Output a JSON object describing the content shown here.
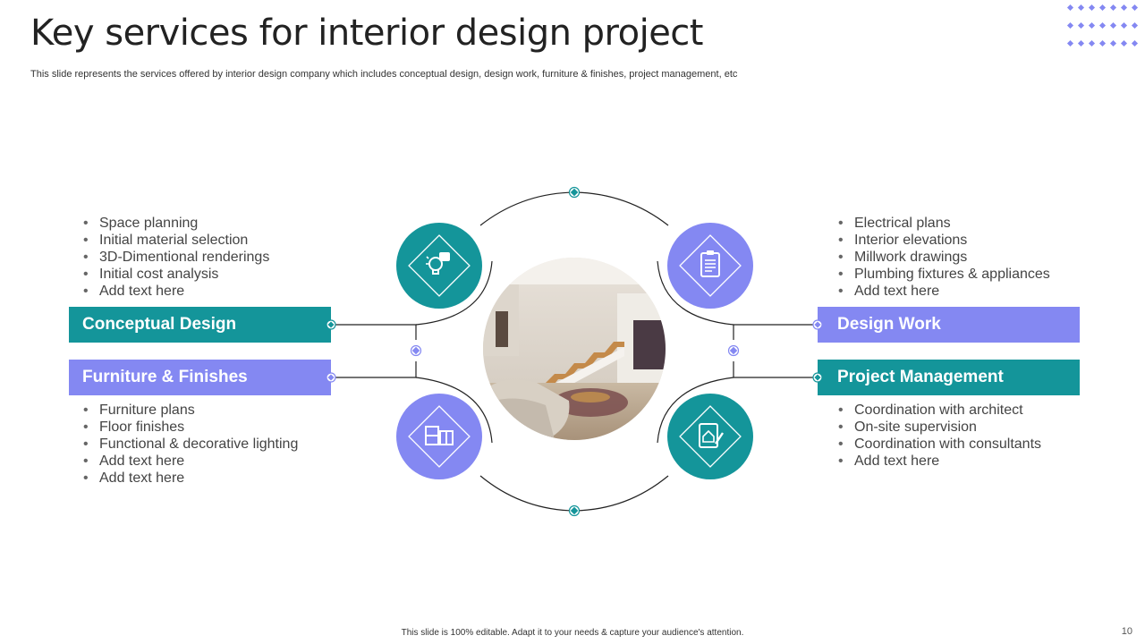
{
  "header": {
    "title": "Key services for interior design project",
    "subtitle": "This slide represents the services offered by interior design company which includes conceptual design, design work, furniture & finishes, project management, etc"
  },
  "colors": {
    "teal": "#14959a",
    "purple": "#8488f2"
  },
  "services": {
    "conceptual": {
      "label": "Conceptual Design",
      "icon": "lightbulb-idea-icon",
      "items": [
        "Space planning",
        "Initial material selection",
        "3D-Dimentional renderings",
        "Initial cost analysis",
        "Add text here"
      ]
    },
    "furniture": {
      "label": "Furniture & Finishes",
      "icon": "furniture-cabinet-icon",
      "items": [
        "Furniture plans",
        "Floor finishes",
        "Functional & decorative lighting",
        "Add text here",
        "Add text here"
      ]
    },
    "design_work": {
      "label": "Design Work",
      "icon": "clipboard-document-icon",
      "items": [
        "Electrical plans",
        "Interior elevations",
        "Millwork drawings",
        "Plumbing fixtures & appliances",
        "Add text here"
      ]
    },
    "project_management": {
      "label": "Project Management",
      "icon": "house-plan-icon",
      "items": [
        "Coordination with architect",
        "On-site supervision",
        "Coordination with consultants",
        "Add text here"
      ]
    }
  },
  "center_image": "interior-living-room-photo",
  "footer": {
    "note": "This slide is 100% editable.  Adapt it to your needs & capture your audience's attention.",
    "page_number": "10"
  }
}
